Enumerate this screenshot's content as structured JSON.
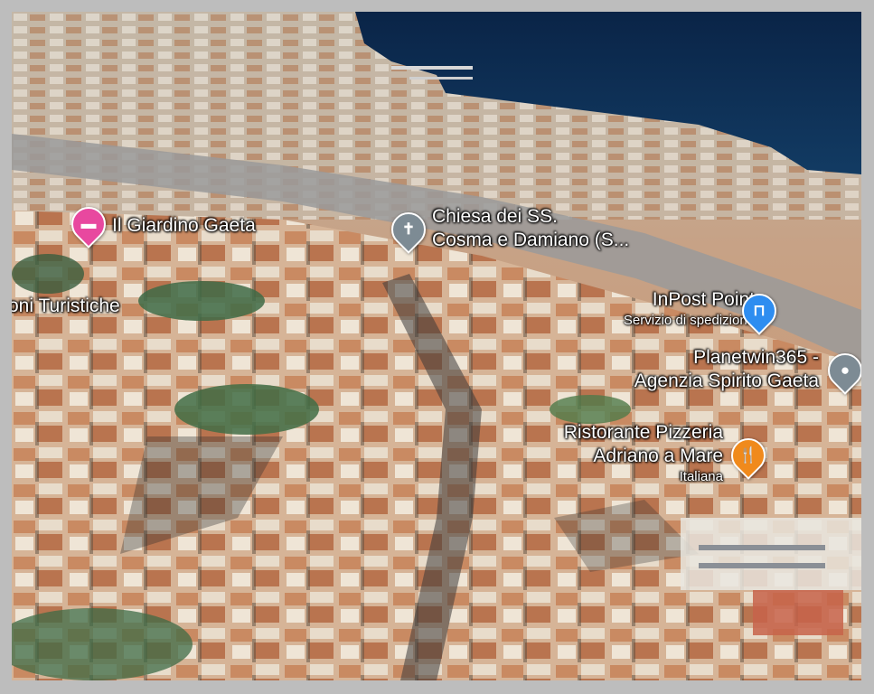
{
  "places": {
    "hotel": {
      "name": "Il Giardino Gaeta",
      "icon": "hotel-bed-icon",
      "color": "#e8489f"
    },
    "church": {
      "line1": "Chiesa dei SS.",
      "line2": "Cosma e Damiano (S...",
      "icon": "church-cross-icon",
      "color": "#7d8b94"
    },
    "partial": {
      "name": "oni Turistiche"
    },
    "inpost": {
      "name": "InPost Point",
      "category": "Servizio di spedizione",
      "icon": "shopping-bag-icon",
      "color": "#2e8df0"
    },
    "planetwin": {
      "line1": "Planetwin365 -",
      "line2": "Agenzia Spirito Gaeta",
      "icon": "location-dot-icon",
      "color": "#7d8b94"
    },
    "restaurant": {
      "line1": "Ristorante Pizzeria",
      "line2": "Adriano a Mare",
      "category": "Italiana",
      "icon": "fork-knife-icon",
      "color": "#f08a1c"
    }
  },
  "colors": {
    "sea": "#0c2d52",
    "roofs": "#c98a62",
    "walls": "#e6d7c2",
    "greenery": "#3e6b46",
    "road": "#8c8c8c",
    "frame": "#bdbdbd"
  }
}
